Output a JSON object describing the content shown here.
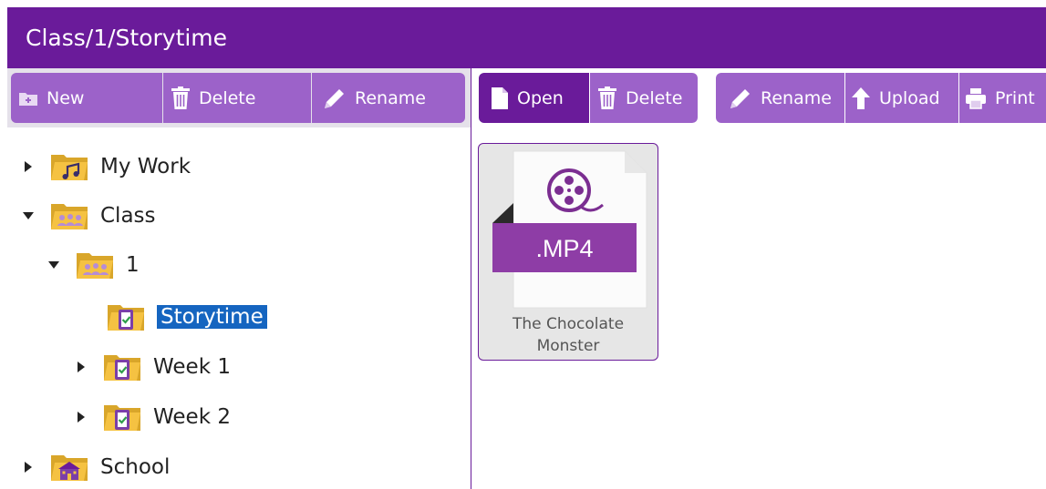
{
  "window": {
    "title": "Class/1/Storytime"
  },
  "colors": {
    "brand": "#6a1b9a",
    "button_light": "#9c62c9",
    "selection": "#1565c0",
    "folder": "#f5c242"
  },
  "folder_toolbar": {
    "new_label": "New",
    "delete_label": "Delete",
    "rename_label": "Rename"
  },
  "file_toolbar": {
    "open_label": "Open",
    "delete_label": "Delete",
    "rename_label": "Rename",
    "upload_label": "Upload",
    "print_label": "Print"
  },
  "tree": {
    "items": [
      {
        "label": "My Work",
        "icon": "folder-music-icon",
        "expanded": false
      },
      {
        "label": "Class",
        "icon": "folder-group-icon",
        "expanded": true
      },
      {
        "label": "1",
        "icon": "folder-group-icon",
        "expanded": true
      },
      {
        "label": "Storytime",
        "icon": "folder-task-icon",
        "selected": true
      },
      {
        "label": "Week 1",
        "icon": "folder-task-icon",
        "expanded": false
      },
      {
        "label": "Week 2",
        "icon": "folder-task-icon",
        "expanded": false
      },
      {
        "label": "School",
        "icon": "folder-school-icon",
        "expanded": false
      }
    ]
  },
  "files": [
    {
      "badge": ".MP4",
      "name_line1": "The Chocolate",
      "name_line2": "Monster",
      "icon": "video-reel-icon"
    }
  ]
}
